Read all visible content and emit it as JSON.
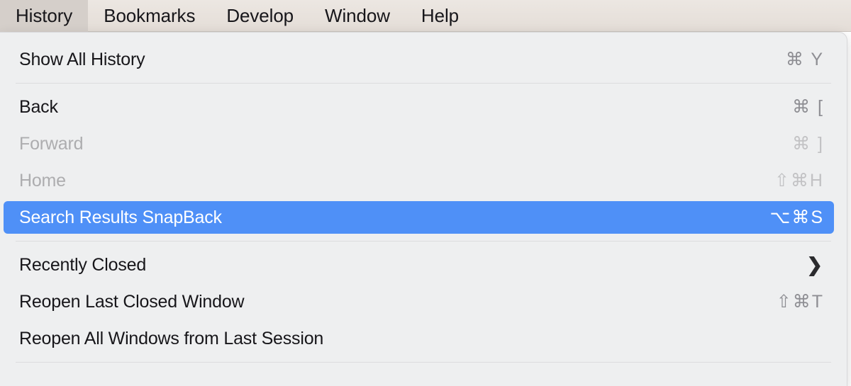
{
  "menubar": {
    "items": [
      {
        "label": "History",
        "active": true
      },
      {
        "label": "Bookmarks",
        "active": false
      },
      {
        "label": "Develop",
        "active": false
      },
      {
        "label": "Window",
        "active": false
      },
      {
        "label": "Help",
        "active": false
      }
    ]
  },
  "menu": {
    "groups": [
      {
        "items": [
          {
            "label": "Show All History",
            "shortcut": "⌘ Y",
            "state": "enabled"
          }
        ]
      },
      {
        "items": [
          {
            "label": "Back",
            "shortcut": "⌘ [",
            "state": "enabled"
          },
          {
            "label": "Forward",
            "shortcut": "⌘ ]",
            "state": "disabled"
          },
          {
            "label": "Home",
            "shortcut": "⇧⌘H",
            "state": "disabled"
          },
          {
            "label": "Search Results SnapBack",
            "shortcut": "⌥⌘S",
            "state": "selected"
          }
        ]
      },
      {
        "items": [
          {
            "label": "Recently Closed",
            "shortcut": "",
            "state": "enabled",
            "submenu": "❯"
          },
          {
            "label": "Reopen Last Closed Window",
            "shortcut": "⇧⌘T",
            "state": "enabled"
          },
          {
            "label": "Reopen All Windows from Last Session",
            "shortcut": "",
            "state": "enabled"
          }
        ]
      }
    ]
  },
  "colors": {
    "menubar_bg": "#e8e2dd",
    "menubar_active_bg": "#d5cfca",
    "panel_bg": "#eeeff0",
    "selection_blue": "#4f90f7",
    "label": "#17161a",
    "label_disabled": "#adadaf",
    "shortcut": "#8e8e93",
    "separator": "#dcdcde"
  }
}
